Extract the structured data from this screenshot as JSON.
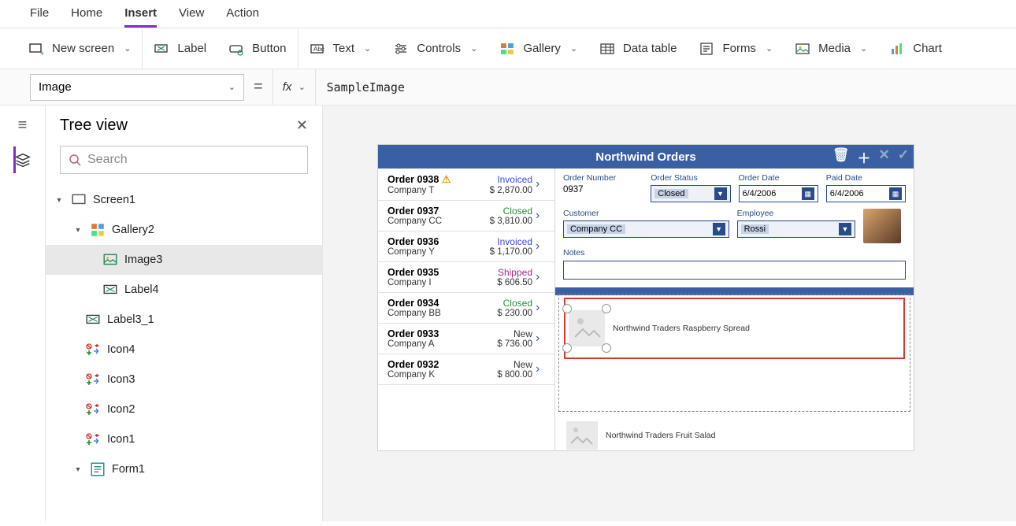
{
  "menu": {
    "file": "File",
    "home": "Home",
    "insert": "Insert",
    "view": "View",
    "action": "Action"
  },
  "ribbon": {
    "new_screen": "New screen",
    "label": "Label",
    "button": "Button",
    "text": "Text",
    "controls": "Controls",
    "gallery": "Gallery",
    "data_table": "Data table",
    "forms": "Forms",
    "media": "Media",
    "chart": "Chart"
  },
  "formula": {
    "property": "Image",
    "fx": "fx",
    "value": "SampleImage"
  },
  "sidepanel": {
    "title": "Tree view",
    "search_placeholder": "Search",
    "nodes": {
      "screen": "Screen1",
      "gallery": "Gallery2",
      "image3": "Image3",
      "label4": "Label4",
      "label3_1": "Label3_1",
      "icon4": "Icon4",
      "icon3": "Icon3",
      "icon2": "Icon2",
      "icon1": "Icon1",
      "form1": "Form1"
    }
  },
  "app": {
    "title": "Northwind Orders",
    "orders": [
      {
        "num": "Order 0938",
        "company": "Company T",
        "status": "Invoiced",
        "price": "$ 2,870.00",
        "warn": true
      },
      {
        "num": "Order 0937",
        "company": "Company CC",
        "status": "Closed",
        "price": "$ 3,810.00"
      },
      {
        "num": "Order 0936",
        "company": "Company Y",
        "status": "Invoiced",
        "price": "$ 1,170.00"
      },
      {
        "num": "Order 0935",
        "company": "Company I",
        "status": "Shipped",
        "price": "$ 606.50"
      },
      {
        "num": "Order 0934",
        "company": "Company BB",
        "status": "Closed",
        "price": "$ 230.00"
      },
      {
        "num": "Order 0933",
        "company": "Company A",
        "status": "New",
        "price": "$ 736.00"
      },
      {
        "num": "Order 0932",
        "company": "Company K",
        "status": "New",
        "price": "$ 800.00"
      }
    ],
    "detail": {
      "labels": {
        "ordnum": "Order Number",
        "ordstat": "Order Status",
        "orddate": "Order Date",
        "paiddate": "Paid Date",
        "cust": "Customer",
        "emp": "Employee",
        "notes": "Notes"
      },
      "values": {
        "ordnum": "0937",
        "ordstat": "Closed",
        "orddate": "6/4/2006",
        "paiddate": "6/4/2006",
        "cust": "Company CC",
        "emp": "Rossi"
      }
    },
    "gallery_items": {
      "sel": "Northwind Traders Raspberry Spread",
      "next": "Northwind Traders Fruit Salad"
    }
  }
}
